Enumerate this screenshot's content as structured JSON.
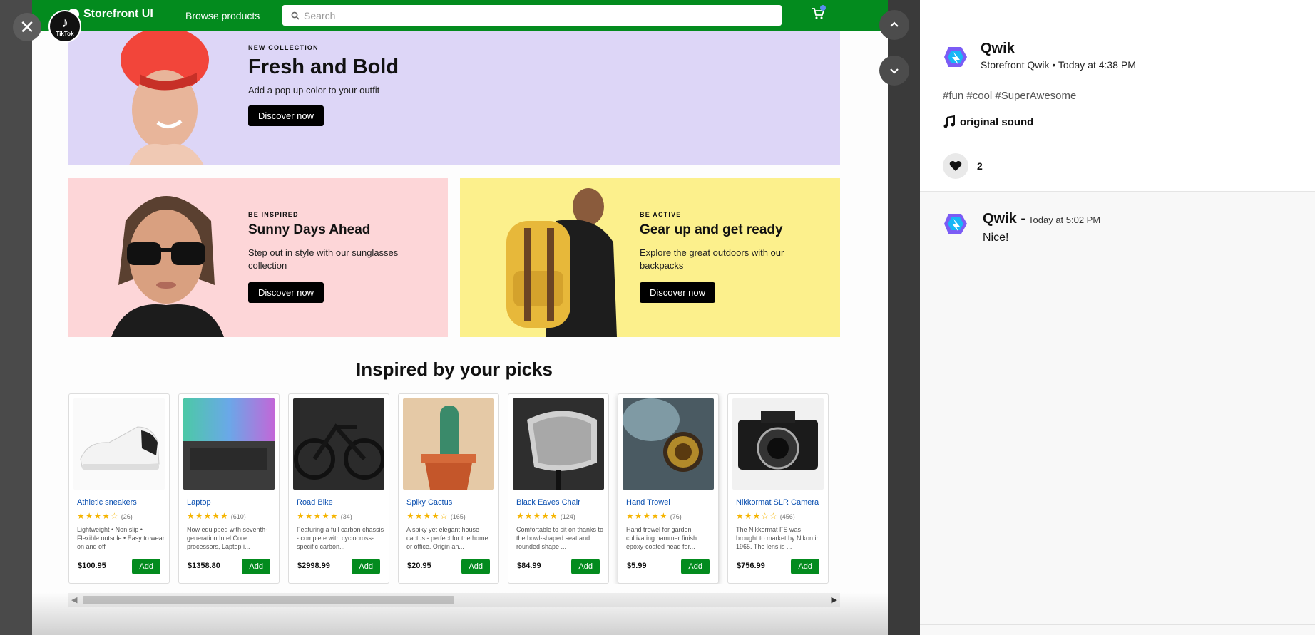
{
  "viewer": {
    "close_glyph": "✕",
    "tiktok_label": "TikTok",
    "store": {
      "logo_text": "Storefront UI",
      "browse_label": "Browse products",
      "search_placeholder": "Search"
    },
    "hero": {
      "eyebrow": "NEW COLLECTION",
      "title": "Fresh and Bold",
      "subtitle": "Add a pop up color to your outfit",
      "cta": "Discover now"
    },
    "promos": [
      {
        "eyebrow": "BE INSPIRED",
        "title": "Sunny Days Ahead",
        "subtitle": "Step out in style with our sunglasses collection",
        "cta": "Discover now"
      },
      {
        "eyebrow": "BE ACTIVE",
        "title": "Gear up and get ready",
        "subtitle": "Explore the great outdoors with our backpacks",
        "cta": "Discover now"
      }
    ],
    "section_title": "Inspired by your picks",
    "add_label": "Add",
    "products": [
      {
        "name": "Athletic sneakers",
        "rating": 4,
        "count": "(26)",
        "desc": "Lightweight • Non slip • Flexible outsole • Easy to wear on and off",
        "price": "$100.95"
      },
      {
        "name": "Laptop",
        "rating": 5,
        "count": "(610)",
        "desc": "Now equipped with seventh-generation Intel Core processors, Laptop i...",
        "price": "$1358.80"
      },
      {
        "name": "Road Bike",
        "rating": 5,
        "count": "(34)",
        "desc": "Featuring a full carbon chassis - complete with cyclocross-specific carbon...",
        "price": "$2998.99"
      },
      {
        "name": "Spiky Cactus",
        "rating": 4,
        "count": "(165)",
        "desc": "A spiky yet elegant house cactus - perfect for the home or office. Origin an...",
        "price": "$20.95"
      },
      {
        "name": "Black Eaves Chair",
        "rating": 5,
        "count": "(124)",
        "desc": "Comfortable to sit on thanks to the bowl-shaped seat and rounded shape ...",
        "price": "$84.99"
      },
      {
        "name": "Hand Trowel",
        "rating": 5,
        "count": "(76)",
        "desc": "Hand trowel for garden cultivating hammer finish epoxy-coated head for...",
        "price": "$5.99"
      },
      {
        "name": "Nikkormat SLR Camera",
        "rating": 3,
        "count": "(456)",
        "desc": "The Nikkormat FS was brought to market by Nikon in 1965. The lens is ...",
        "price": "$756.99"
      }
    ]
  },
  "panel": {
    "post": {
      "author": "Qwik",
      "meta": "Storefront Qwik • Today at 4:38 PM",
      "tags": "#fun #cool #SuperAwesome",
      "sound": "original sound",
      "likes": "2"
    },
    "comment": {
      "author": "Qwik -",
      "time": "Today at 5:02 PM",
      "text": "Nice!"
    }
  },
  "colors": {
    "store_green": "#038b1e",
    "hero_lavender": "#ddd6f7",
    "promo_pink": "#fdd6d8",
    "promo_yellow": "#fcf08c",
    "link_blue": "#0a4fb0",
    "star": "#f5b400",
    "qwik_purple": "#7b5cf5",
    "qwik_blue": "#18b6f6"
  }
}
